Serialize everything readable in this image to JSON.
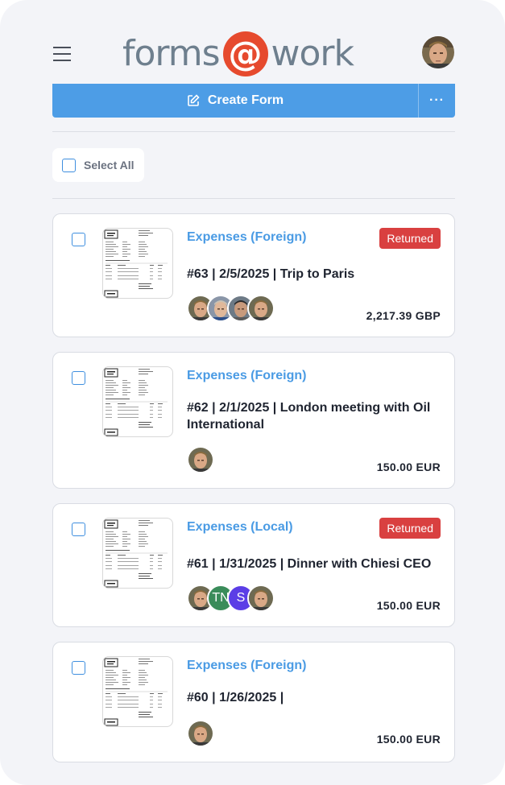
{
  "header": {
    "logo_left": "forms",
    "logo_at": "@",
    "logo_right": "work",
    "menu_icon": "hamburger-menu-icon",
    "avatar_icon": "user-avatar"
  },
  "toolbar": {
    "create_label": "Create Form",
    "create_icon": "pencil-square-icon",
    "more_label": "···",
    "accent_color": "#4d9de6"
  },
  "select_all": {
    "label": "Select All"
  },
  "forms": [
    {
      "type": "Expenses (Foreign)",
      "status": "Returned",
      "title": "#63 | 2/5/2025 | Trip to Paris",
      "amount": "2,217.39 GBP",
      "approvers": [
        "photo-man-1",
        "photo-man-2",
        "photo-man-3",
        "photo-man-1"
      ]
    },
    {
      "type": "Expenses (Foreign)",
      "status": "",
      "title": "#62 | 2/1/2025 | London meeting with Oil International",
      "amount": "150.00 EUR",
      "approvers": [
        "photo-man-1"
      ]
    },
    {
      "type": "Expenses (Local)",
      "status": "Returned",
      "title": "#61 | 1/31/2025 | Dinner with Chiesi CEO",
      "amount": "150.00 EUR",
      "approvers": [
        "photo-man-1",
        "TN",
        "S",
        "photo-man-1"
      ]
    },
    {
      "type": "Expenses (Foreign)",
      "status": "",
      "title": "#60 | 1/26/2025 |",
      "amount": "150.00 EUR",
      "approvers": [
        "photo-man-1"
      ]
    }
  ],
  "colors": {
    "returned_badge": "#d94040",
    "link": "#4a9be4",
    "initial_tn": "#3a8c5a",
    "initial_s": "#5b3ee6"
  }
}
